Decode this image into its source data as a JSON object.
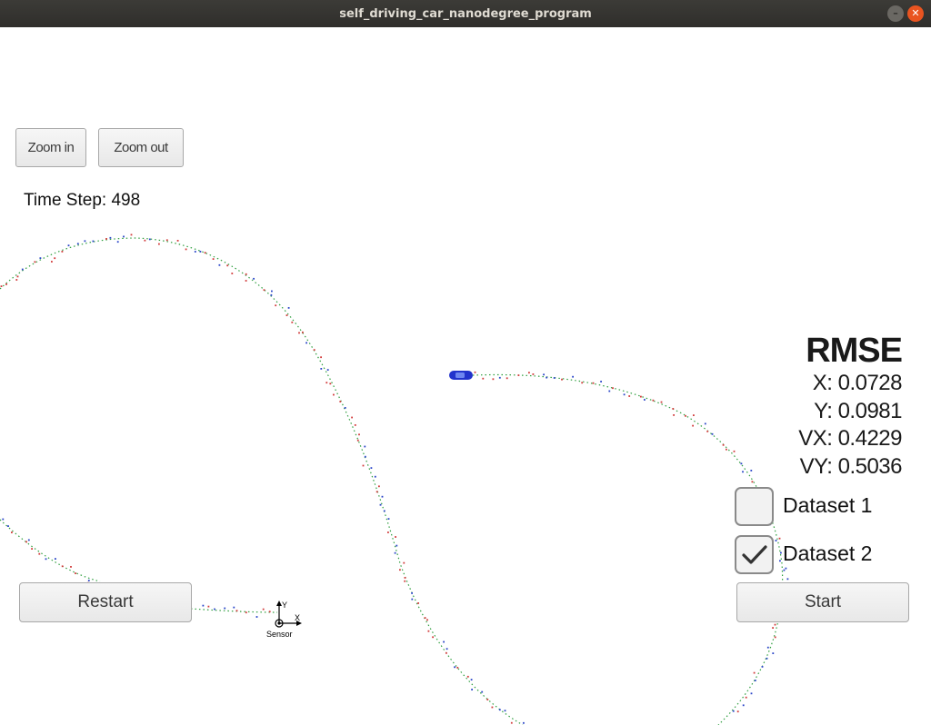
{
  "window": {
    "title": "self_driving_car_nanodegree_program",
    "minimize_symbol": "–",
    "close_symbol": "✕"
  },
  "toolbar": {
    "zoom_in_label": "Zoom in",
    "zoom_out_label": "Zoom out"
  },
  "timestep": {
    "label": "Time Step: 498"
  },
  "rmse": {
    "title": "RMSE",
    "x": "X: 0.0728",
    "y": "Y: 0.0981",
    "vx": "VX: 0.4229",
    "vy": "VY: 0.5036"
  },
  "datasets": [
    {
      "label": "Dataset 1",
      "checked": false
    },
    {
      "label": "Dataset 2",
      "checked": true
    }
  ],
  "controls": {
    "restart_label": "Restart",
    "start_label": "Start"
  },
  "sensor": {
    "label": "Sensor",
    "x_axis_label": "X",
    "y_axis_label": "Y"
  },
  "colors": {
    "ground_truth": "#2e9e3e",
    "lidar": "#d23b3b",
    "radar": "#2a45c8",
    "car": "#2233cc"
  },
  "icons": {
    "checkmark": "check-icon",
    "car": "car-icon"
  }
}
